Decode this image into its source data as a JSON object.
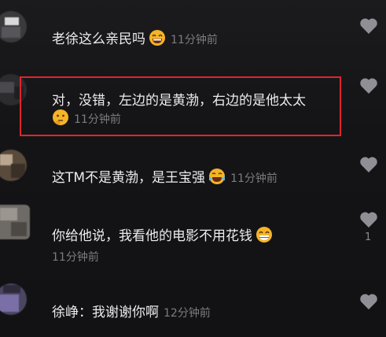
{
  "comments": [
    {
      "text": "老徐这么亲民吗",
      "time": "11分钟前",
      "emoji": "grin-emoji"
    },
    {
      "text": "对，没错，左边的是黄渤，右边的是他太太",
      "time": "11分钟前",
      "emoji": "pondering-emoji"
    },
    {
      "text": "这TM不是黄渤，是王宝强",
      "time": "11分钟前",
      "emoji": "tears-of-joy-emoji"
    },
    {
      "text": "你给他说，我看他的电影不用花钱",
      "time": "11分钟前",
      "emoji": "grin-emoji",
      "likes": "1"
    },
    {
      "text": "徐峥：我谢谢你啊",
      "time": "12分钟前"
    }
  ],
  "colors": {
    "background": "#161618",
    "text": "#ececef",
    "time": "#7c7c82",
    "highlight": "#e0242b",
    "heart": "#8f8f95"
  }
}
